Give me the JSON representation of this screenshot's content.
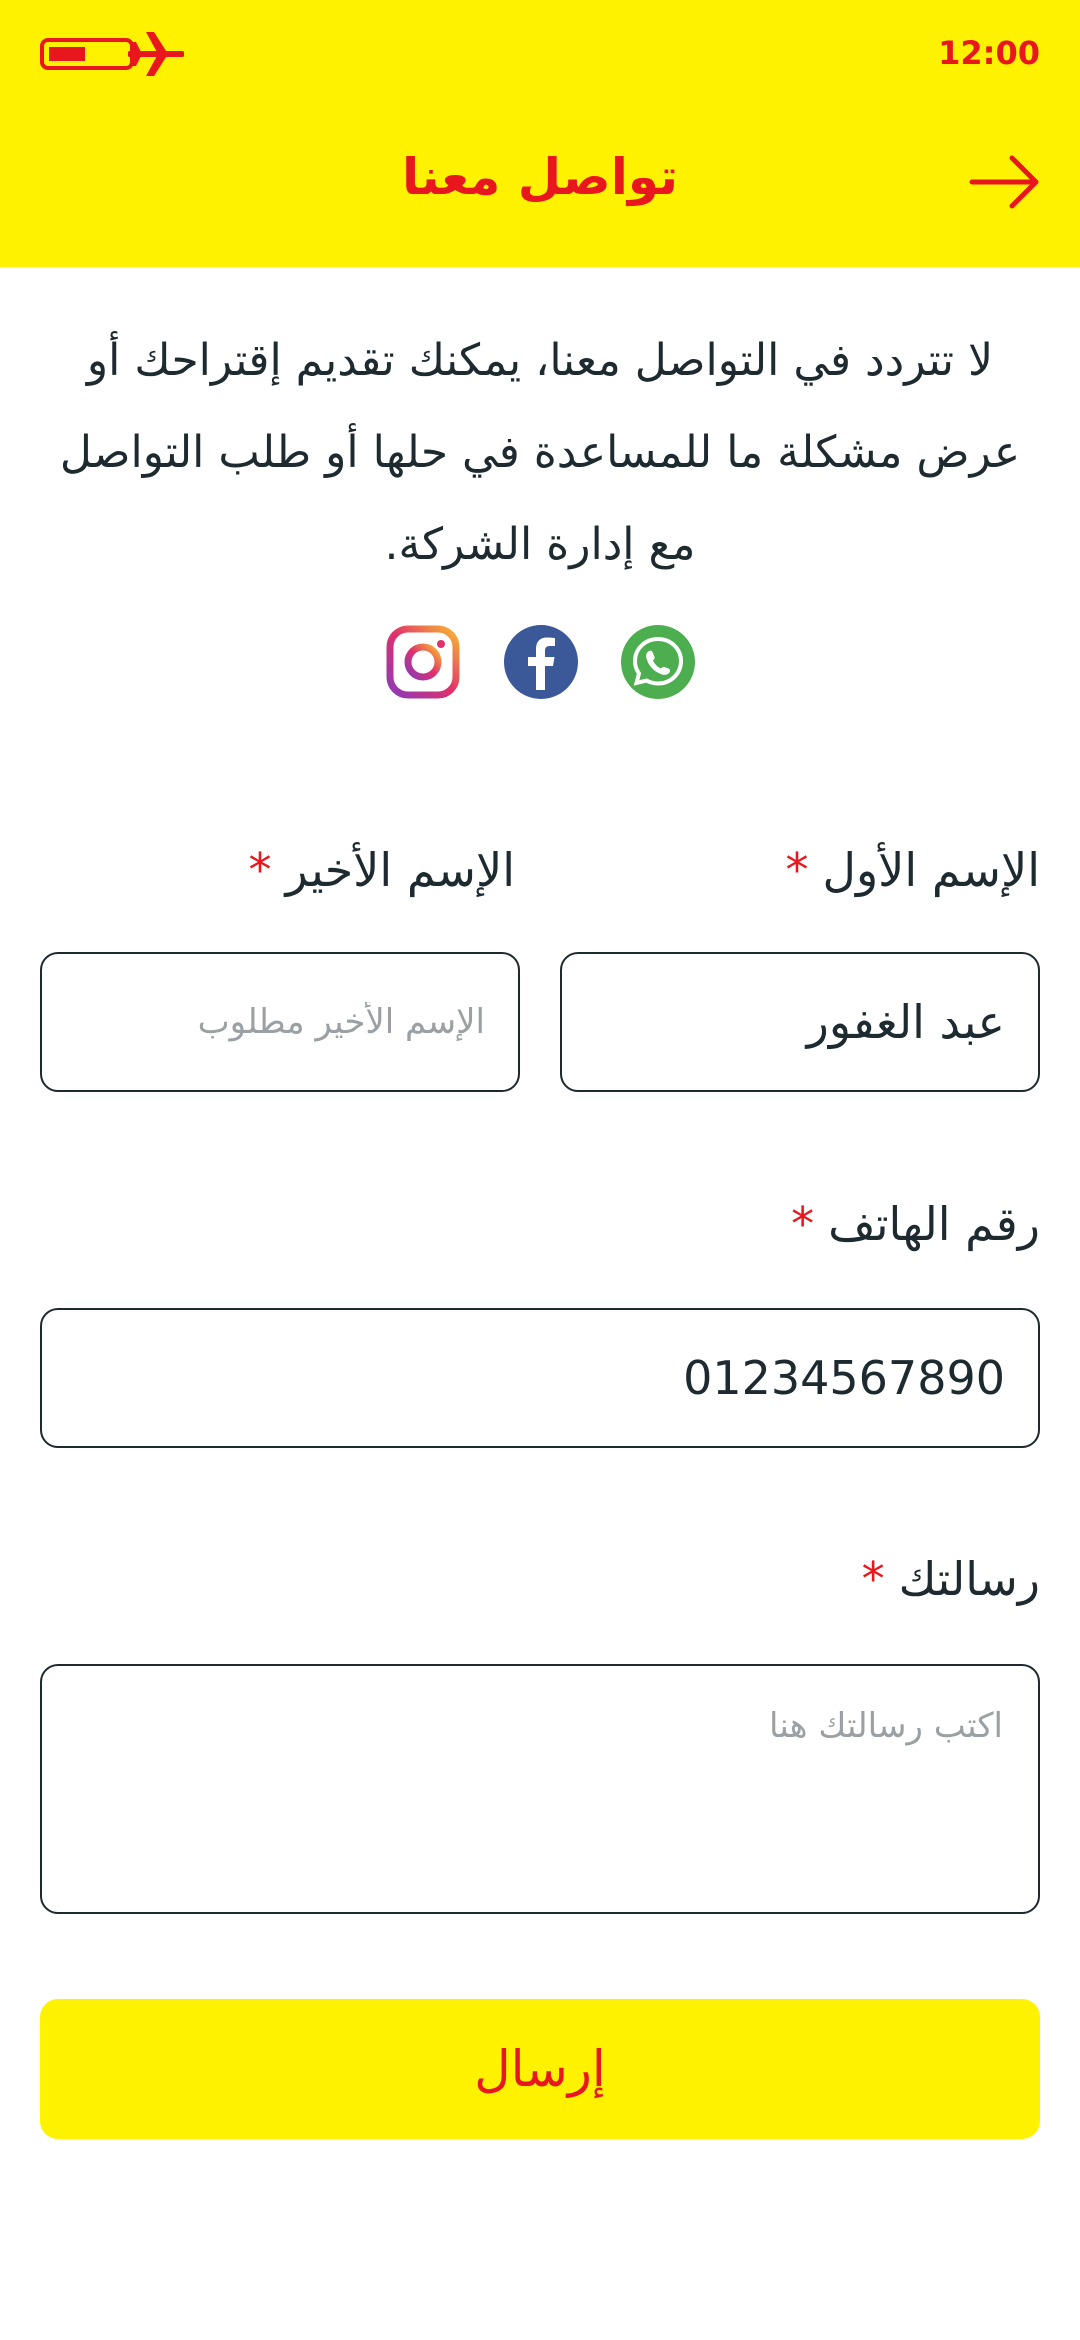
{
  "status_bar": {
    "time": "12:00",
    "battery_icon": "battery-low-icon",
    "airplane_icon": "airplane-mode-icon"
  },
  "header": {
    "title": "تواصل معنا",
    "back_icon": "arrow-right-icon"
  },
  "intro_text": "لا تتردد في التواصل معنا، يمكنك تقديم إقتراحك أو عرض مشكلة ما للمساعدة في حلها أو طلب التواصل مع إدارة الشركة.",
  "social": [
    "instagram-icon",
    "facebook-icon",
    "whatsapp-icon"
  ],
  "form": {
    "first_name": {
      "label": "الإسم الأول",
      "required_mark": "*",
      "value": "عبد الغفور",
      "placeholder": ""
    },
    "last_name": {
      "label": "الإسم الأخير",
      "required_mark": "*",
      "value": "",
      "placeholder": "الإسم الأخير مطلوب"
    },
    "phone": {
      "label": "رقم الهاتف",
      "required_mark": "*",
      "value": "01234567890",
      "placeholder": ""
    },
    "message": {
      "label": "رسالتك",
      "required_mark": "*",
      "value": "",
      "placeholder": "اكتب رسالتك هنا"
    },
    "submit_label": "إرسال"
  },
  "colors": {
    "accent_yellow": "#fff200",
    "accent_red": "#e8171d",
    "text_dark": "#1d2a30"
  }
}
